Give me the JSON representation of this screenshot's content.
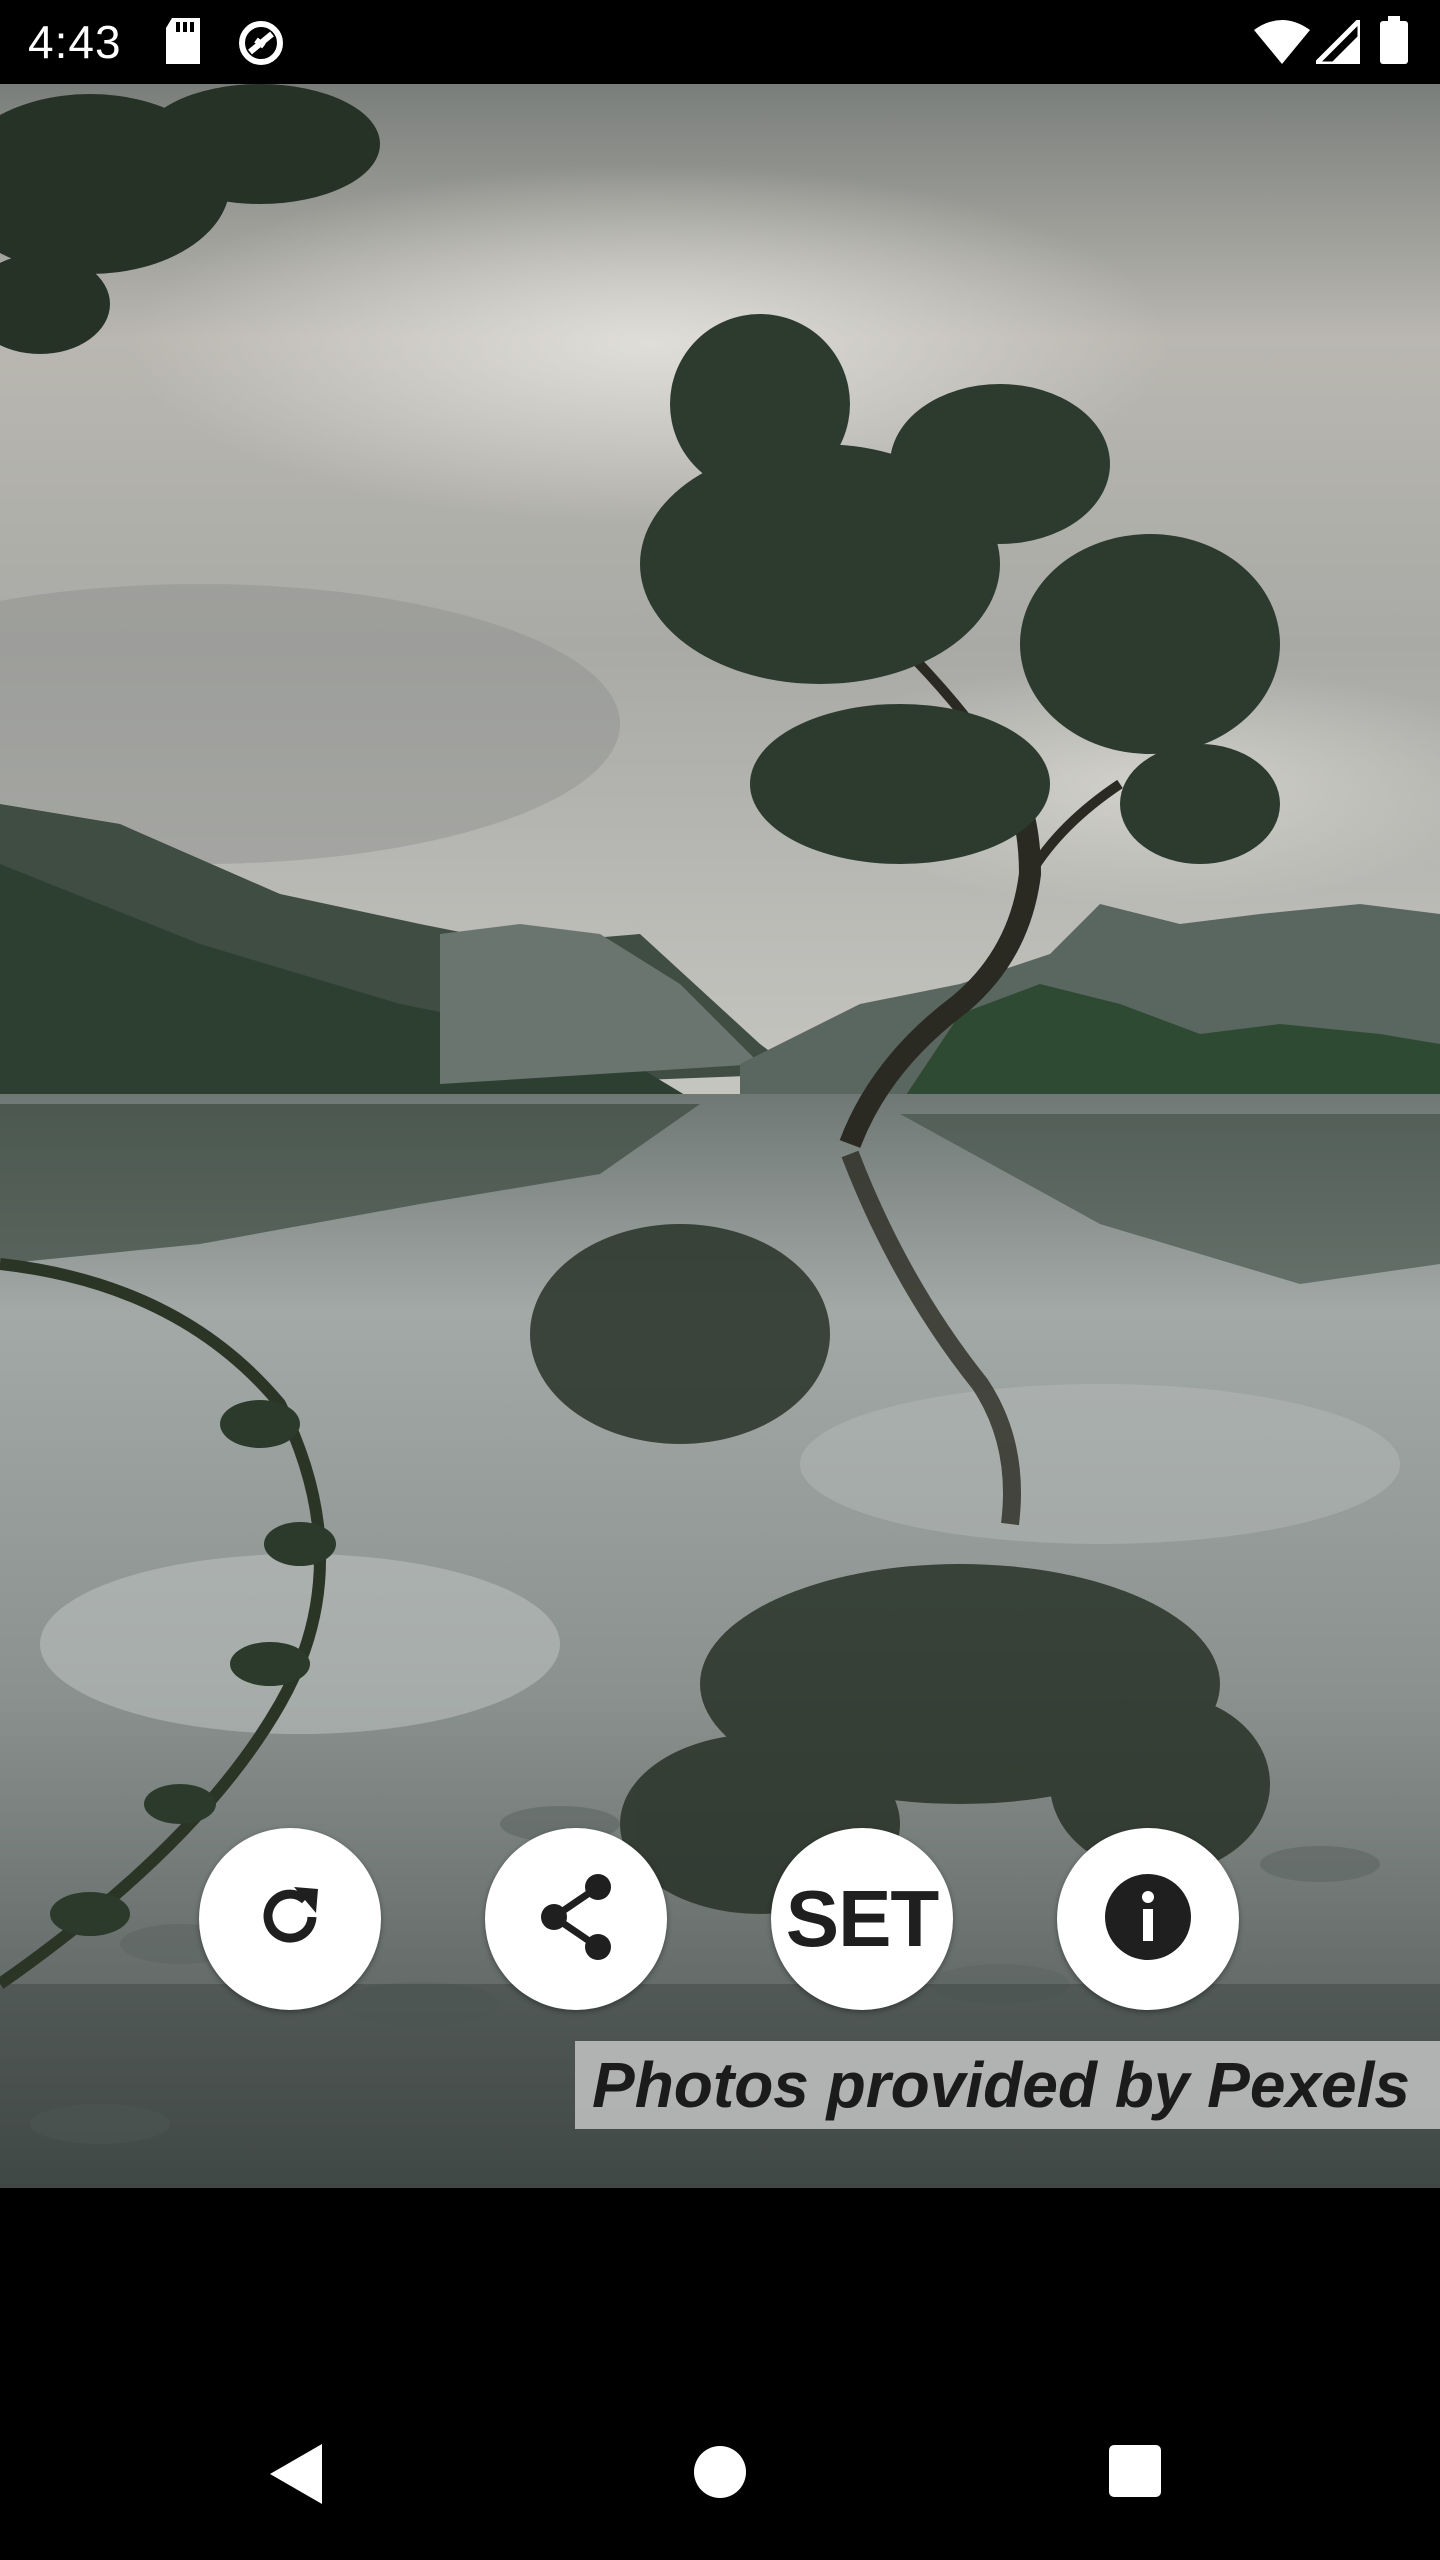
{
  "status_bar": {
    "time": "4:43",
    "icons": [
      "sd-card-icon",
      "sync-icon",
      "wifi-icon",
      "signal-icon",
      "battery-icon"
    ]
  },
  "photo": {
    "subject": "lone-tree-lake-landscape"
  },
  "actions": {
    "refresh_icon": "refresh-icon",
    "share_icon": "share-icon",
    "set_label": "SET",
    "info_icon": "info-icon"
  },
  "credit": {
    "text": "Photos provided by Pexels"
  },
  "nav_bar": {
    "back_icon": "back-icon",
    "home_icon": "home-icon",
    "recents_icon": "recents-icon"
  },
  "colors": {
    "button_bg": "#ffffff",
    "credit_bg": "#c8c8c8",
    "bar_bg": "#000000"
  }
}
